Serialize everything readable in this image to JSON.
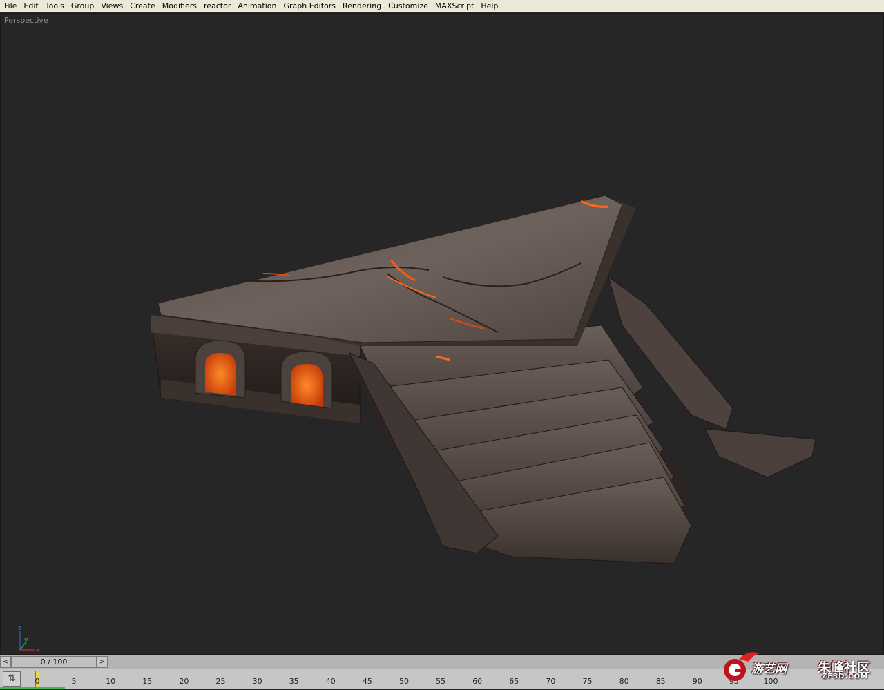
{
  "menu": [
    "File",
    "Edit",
    "Tools",
    "Group",
    "Views",
    "Create",
    "Modifiers",
    "reactor",
    "Animation",
    "Graph Editors",
    "Rendering",
    "Customize",
    "MAXScript",
    "Help"
  ],
  "viewport": {
    "label": "Perspective"
  },
  "axis_labels": {
    "x": "x",
    "y": "y",
    "z": "z"
  },
  "time_slider": {
    "left_arrow": "<",
    "value": "0 / 100",
    "right_arrow": ">"
  },
  "timeline": {
    "ticks": [
      "0",
      "5",
      "10",
      "15",
      "20",
      "25",
      "30",
      "35",
      "40",
      "45",
      "50",
      "55",
      "60",
      "65",
      "70",
      "75",
      "80",
      "85",
      "90",
      "95",
      "100"
    ],
    "current_frame": 0
  },
  "watermark": {
    "text1": "游艺网",
    "text2": "朱峰社区",
    "text3": "ZF3D.COM"
  },
  "colors": {
    "lava": "#ff6a1a",
    "stone": "#5e5550",
    "background": "#262626"
  }
}
